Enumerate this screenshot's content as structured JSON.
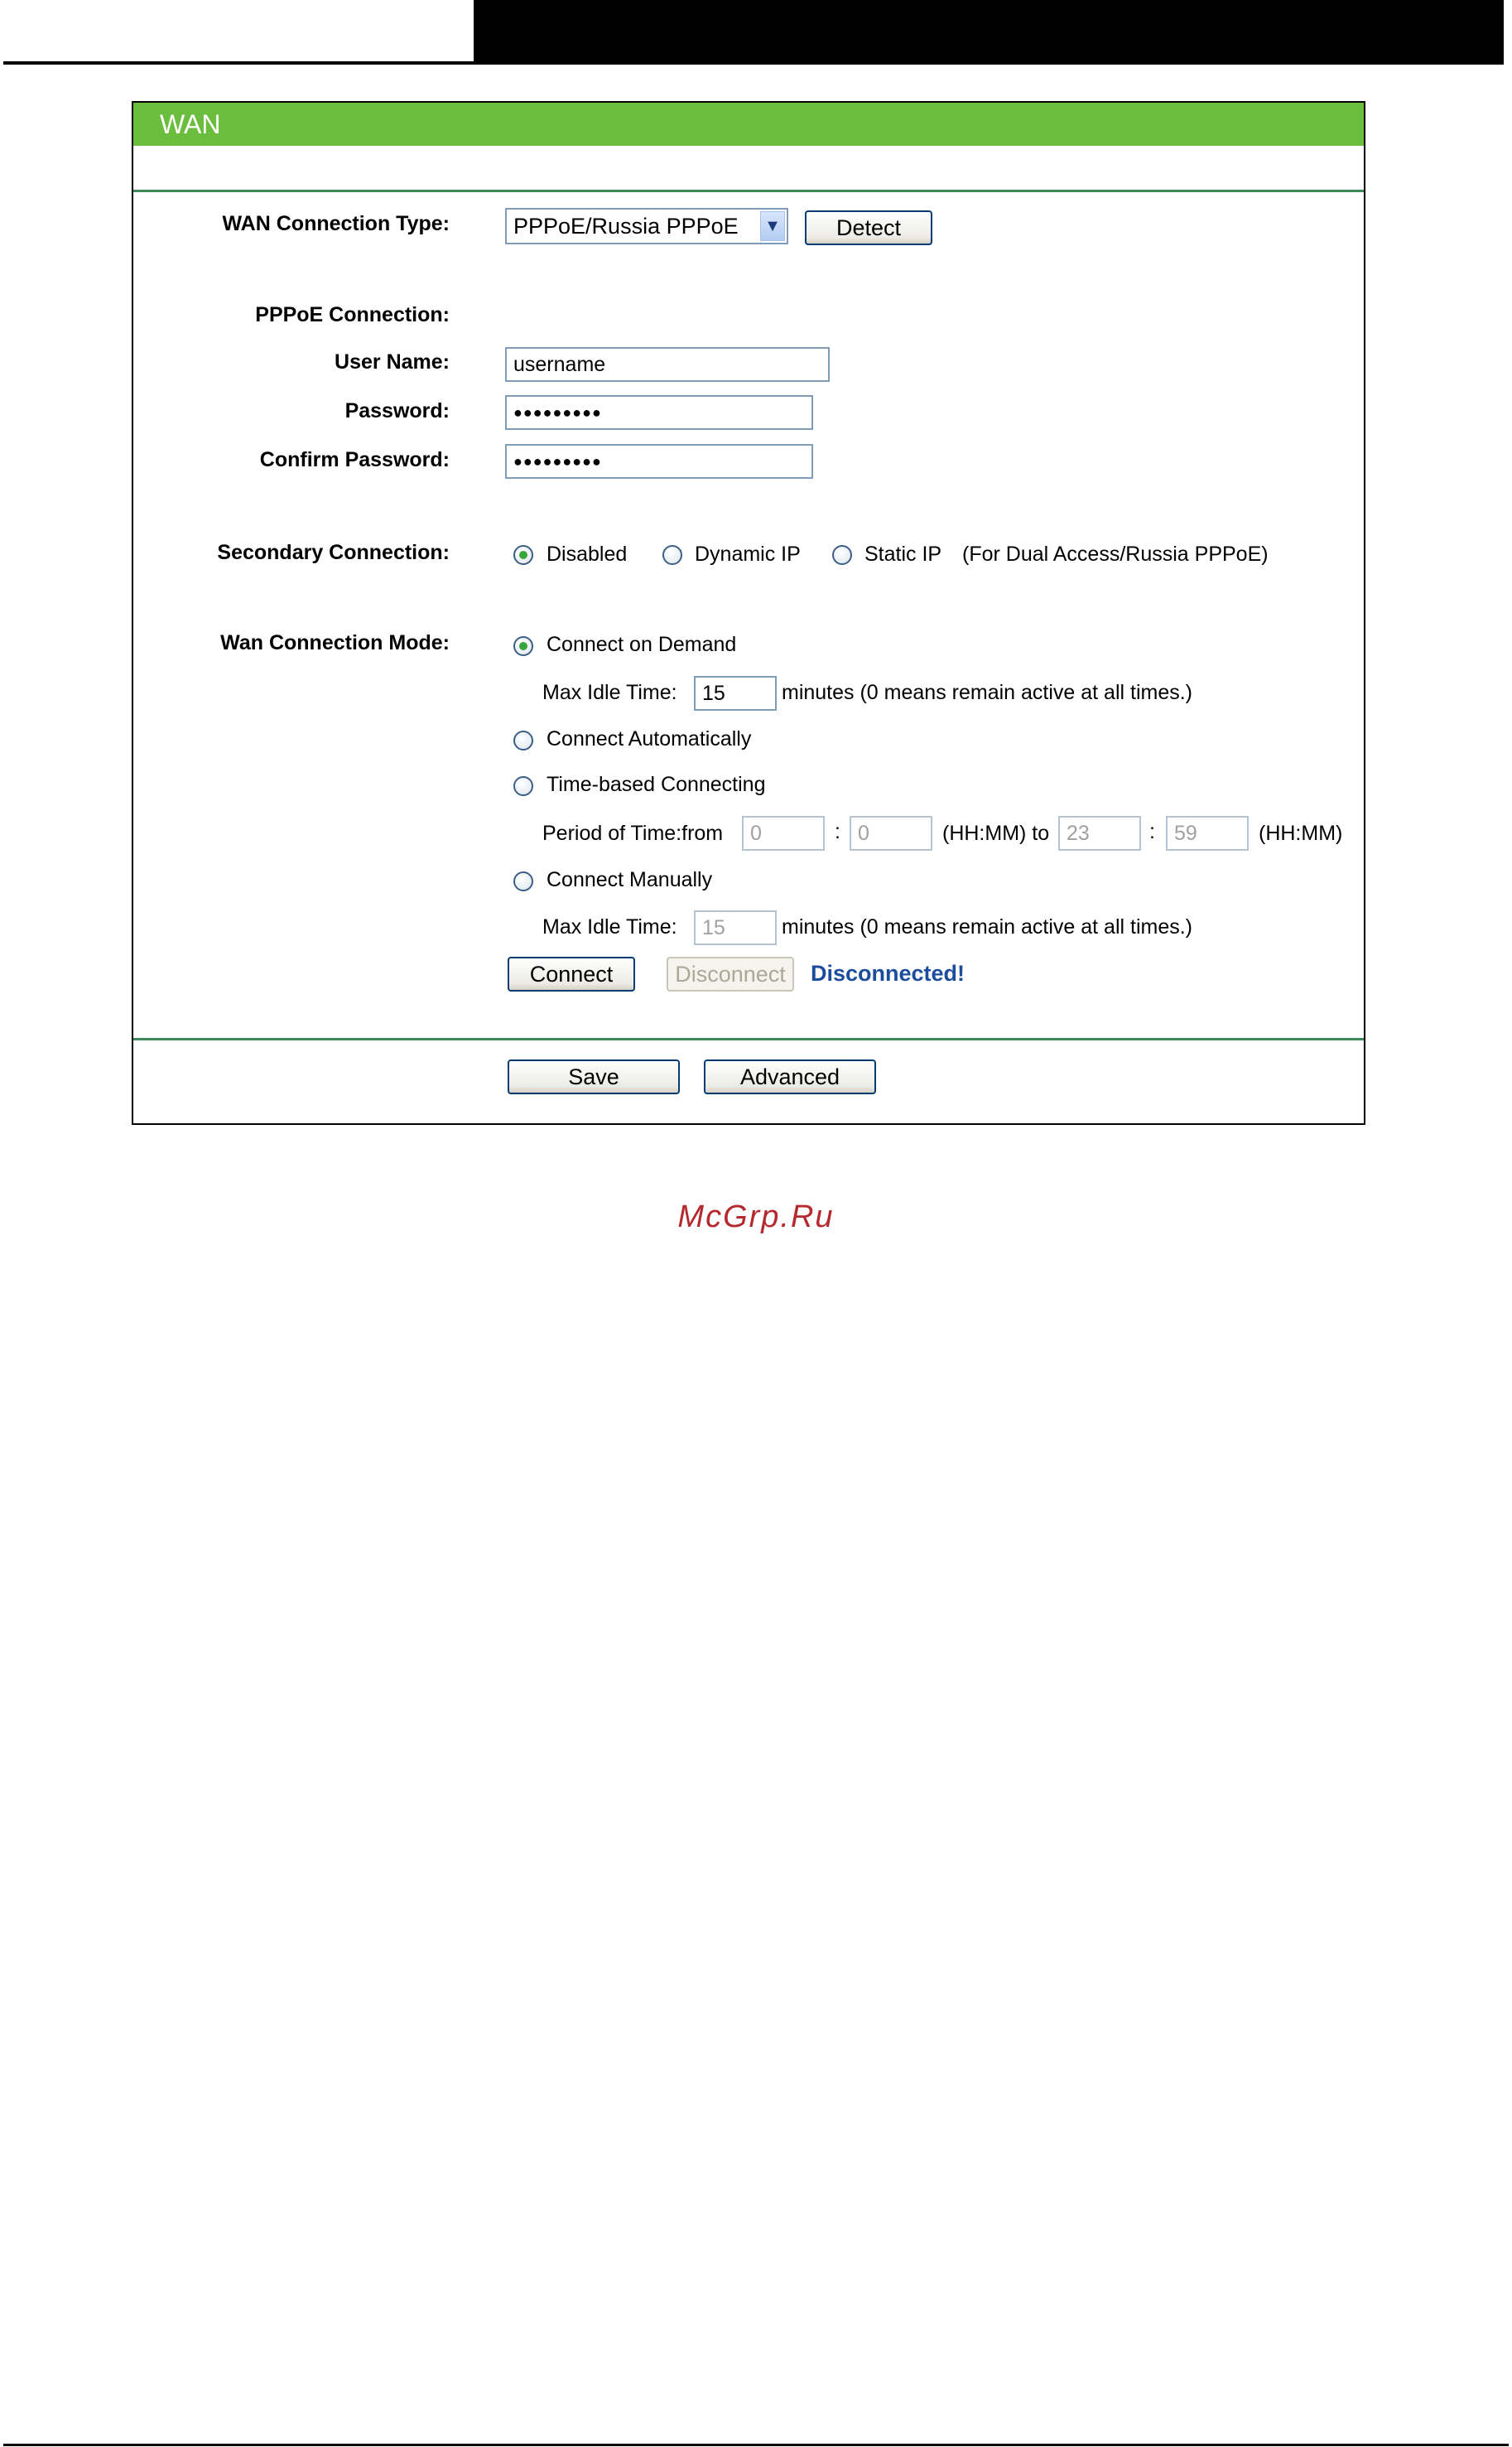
{
  "panel": {
    "title": "WAN"
  },
  "connection_type": {
    "label": "WAN Connection Type:",
    "selected": "PPPoE/Russia PPPoE",
    "detect_label": "Detect"
  },
  "pppoe": {
    "section_label": "PPPoE Connection:",
    "username_label": "User Name:",
    "username_value": "username",
    "password_label": "Password:",
    "password_value": "●●●●●●●●●",
    "confirm_label": "Confirm Password:",
    "confirm_value": "●●●●●●●●●"
  },
  "secondary": {
    "label": "Secondary Connection:",
    "options": [
      "Disabled",
      "Dynamic IP",
      "Static IP"
    ],
    "selected": "Disabled",
    "note": "(For Dual Access/Russia PPPoE)"
  },
  "mode": {
    "label": "Wan Connection Mode:",
    "selected": "Connect on Demand",
    "on_demand_label": "Connect on Demand",
    "max_idle_label": "Max Idle Time:",
    "max_idle_value": "15",
    "max_idle_note": "minutes (0 means remain active at all times.)",
    "auto_label": "Connect Automatically",
    "time_based_label": "Time-based Connecting",
    "period_label": "Period of Time:from",
    "from_hh": "0",
    "from_mm": "0",
    "colon": ":",
    "to_label": "(HH:MM) to",
    "to_hh": "23",
    "to_mm": "59",
    "hhmm_label": "(HH:MM)",
    "manual_label": "Connect Manually",
    "manual_idle_label": "Max Idle Time:",
    "manual_idle_value": "15",
    "manual_idle_note": "minutes (0 means remain active at all times.)"
  },
  "actions": {
    "connect_label": "Connect",
    "disconnect_label": "Disconnect",
    "status": "Disconnected!",
    "save_label": "Save",
    "advanced_label": "Advanced"
  },
  "watermark": "McGrp.Ru",
  "colors": {
    "title_bar": "#6bbd3d",
    "rule": "#3b8b5a",
    "status": "#1c4d9c",
    "watermark": "#b5292e"
  }
}
